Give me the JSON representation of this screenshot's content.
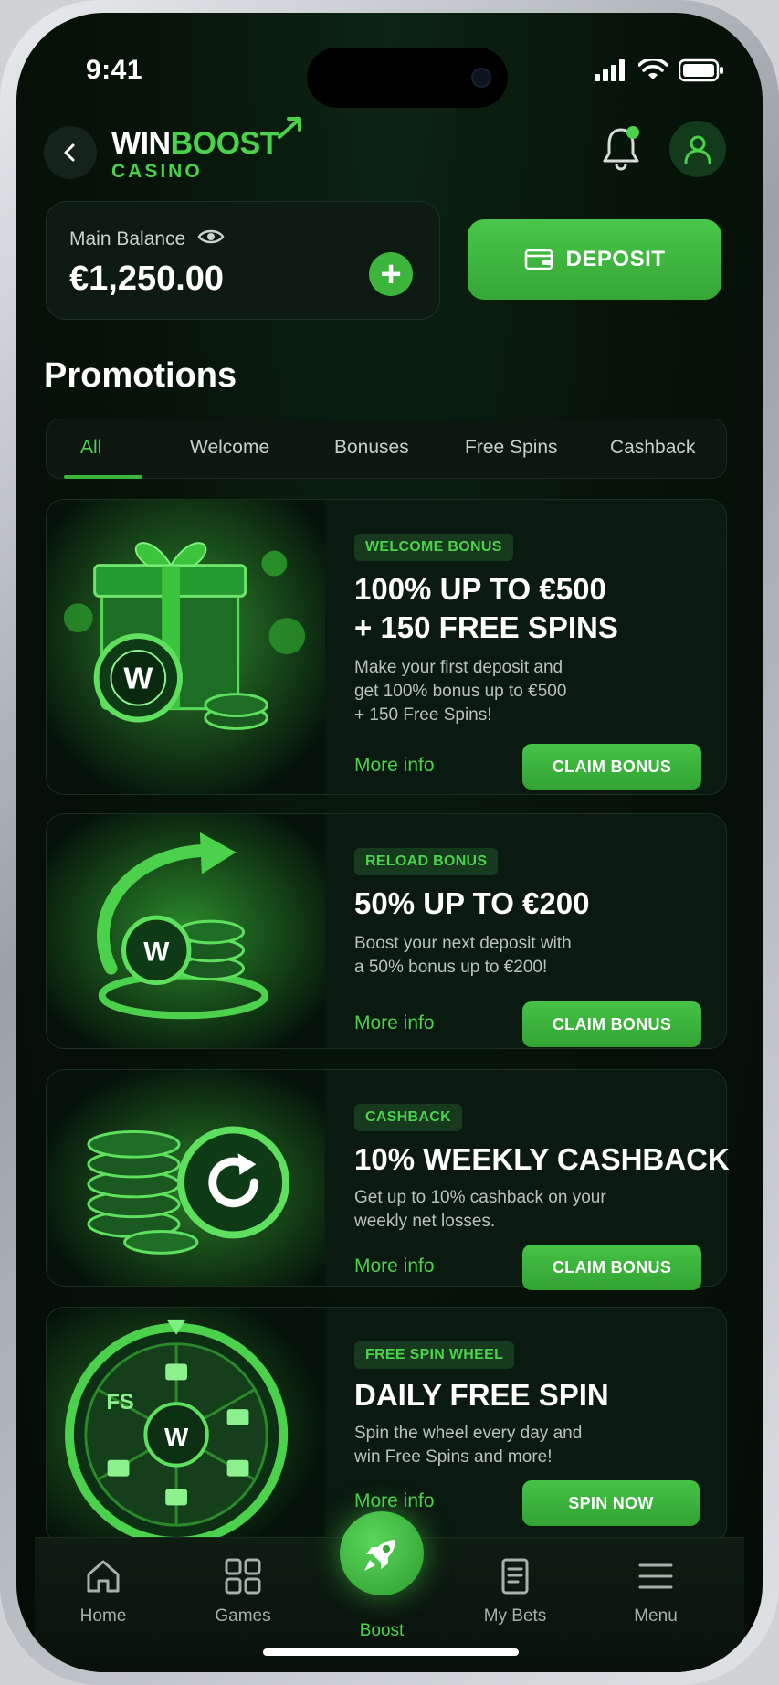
{
  "status_bar": {
    "time": "9:41"
  },
  "header": {
    "logo_win": "WIN",
    "logo_boost": "BOOST",
    "logo_sub": "CASINO",
    "icons": [
      "back-arrow-icon",
      "bell-icon",
      "user-icon"
    ]
  },
  "balance": {
    "label": "Main Balance",
    "value": "€1,250.00"
  },
  "deposit": {
    "label": "DEPOSIT"
  },
  "promotions": {
    "title": "Promotions",
    "tabs": [
      "All",
      "Welcome",
      "Bonuses",
      "Free Spins",
      "Cashback"
    ],
    "active_tab": "All",
    "cards": [
      {
        "tag": "WELCOME BONUS",
        "title_line1": "100% UP TO €500",
        "title_line2": "+ 150 FREE SPINS",
        "desc_line1": "Make your first deposit and",
        "desc_line2": "get 100% bonus up to €500",
        "desc_line3": "+ 150 Free Spins!",
        "more": "More info",
        "button": "CLAIM BONUS",
        "image": "gift-box-chips"
      },
      {
        "tag": "RELOAD BONUS",
        "title_line1": "50% UP TO €200",
        "desc_line1": "Boost your next deposit with",
        "desc_line2": "a 50% bonus up to €200!",
        "more": "More info",
        "button": "CLAIM BONUS",
        "image": "reload-chips"
      },
      {
        "tag": "CASHBACK",
        "title_line1": "10% WEEKLY CASHBACK",
        "desc_line1": "Get up to 10% cashback on your",
        "desc_line2": "weekly net losses.",
        "more": "More info",
        "button": "CLAIM BONUS",
        "image": "cashback-chips"
      },
      {
        "tag": "FREE SPIN WHEEL",
        "title_line1": "DAILY FREE SPIN",
        "desc_line1": "Spin the wheel every day and",
        "desc_line2": "win Free Spins and more!",
        "more": "More info",
        "button": "SPIN NOW",
        "image": "prize-wheel",
        "wheel_fs": "FS",
        "wheel_w": "W"
      }
    ]
  },
  "nav": {
    "items": [
      {
        "label": "Home",
        "icon": "home-icon"
      },
      {
        "label": "Games",
        "icon": "grid-icon"
      },
      {
        "label": "Boost",
        "icon": "rocket-icon",
        "active": true
      },
      {
        "label": "My Bets",
        "icon": "receipt-icon"
      },
      {
        "label": "Menu",
        "icon": "hamburger-icon"
      }
    ]
  },
  "colors": {
    "accent": "#4cd14c",
    "button": "#3db53d",
    "bg": "#050c07",
    "card": "#0b1a10"
  }
}
